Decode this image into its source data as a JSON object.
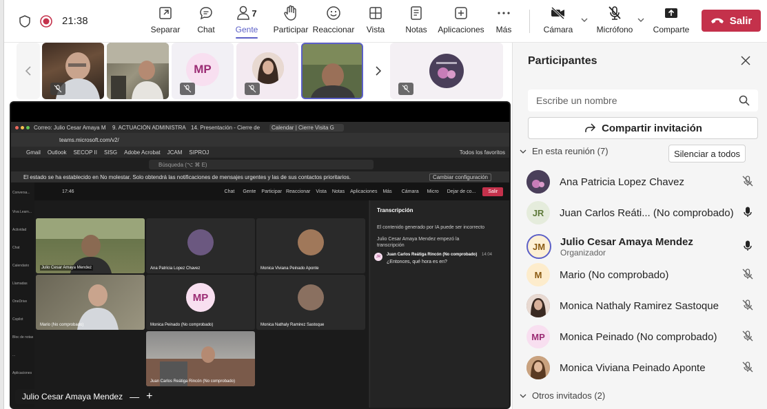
{
  "toolbar": {
    "time": "21:38",
    "buttons": [
      {
        "label": "Separar",
        "icon": "popout-icon"
      },
      {
        "label": "Chat",
        "icon": "chat-icon"
      },
      {
        "label": "Gente",
        "icon": "people-icon",
        "count": "7"
      },
      {
        "label": "Participar",
        "icon": "raise-hand-icon"
      },
      {
        "label": "Reaccionar",
        "icon": "react-icon"
      },
      {
        "label": "Vista",
        "icon": "view-icon"
      },
      {
        "label": "Notas",
        "icon": "notes-icon"
      },
      {
        "label": "Aplicaciones",
        "icon": "apps-icon"
      },
      {
        "label": "Más",
        "icon": "more-icon"
      }
    ],
    "camera_label": "Cámara",
    "mic_label": "Micrófono",
    "share_label": "Comparte",
    "leave_label": "Salir"
  },
  "strip": {
    "thumbs": [
      {
        "name": "video-1"
      },
      {
        "name": "video-2"
      },
      {
        "name": "avatar-mp",
        "initials": "MP"
      },
      {
        "name": "avatar-woman-1"
      },
      {
        "name": "video-3-selected"
      },
      {
        "name": "avatar-flower"
      }
    ]
  },
  "shared": {
    "tabs": [
      "Correo: Julio Cesar Amaya M",
      "9. ACTUACIÓN ADMINISTRA",
      "14. Presentación - Cierre de",
      "Calendar | Cierre Visita G"
    ],
    "url": "teams.microsoft.com/v2/",
    "bookmarks": [
      "Gmail",
      "Outlook",
      "SECOP II",
      "SISG",
      "Adobe Acrobat",
      "JCAM",
      "SIPROJ",
      "Todos los favoritos"
    ],
    "search_placeholder": "Búsqueda (⌥ ⌘ E)",
    "notice": "El estado se ha establecido en No molestar. Solo obtendrá las notificaciones de mensajes urgentes y las de sus contactos prioritarios.",
    "notice_button": "Cambiar configuración",
    "inner_time": "17:46",
    "inner_leave": "Salir",
    "inner_buttons": [
      "Chat",
      "Gente",
      "Participar",
      "Reaccionar",
      "Vista",
      "Notas",
      "Aplicaciones",
      "Más",
      "Cámara",
      "Micro",
      "Dejar de co..."
    ],
    "inner_people_count": "7",
    "rail": [
      "Conversa...",
      "Viva Learn...",
      "Actividad",
      "Chat",
      "Calendario",
      "Llamadas",
      "OneDrive",
      "Copilot",
      "Bloc de notas",
      "...",
      "Aplicaciones"
    ],
    "tiles": [
      {
        "label": "Julio Cesar Amaya Mendez"
      },
      {
        "label": "Ana Patricia Lopez Chavez"
      },
      {
        "label": "Monica Viviana Peinado Aponte"
      },
      {
        "label": "Mario (No comprobado)"
      },
      {
        "label": "Monica Peinado (No comprobado)",
        "initials": "MP"
      },
      {
        "label": "Monica Nathaly Ramirez Sastoque"
      },
      {
        "label": "Juan Carlos Reátiga Rincón (No comprobado)"
      }
    ],
    "transcript": {
      "title": "Transcripción",
      "ai_note": "El contenido generado por IA puede ser incorrecto",
      "started": "Julio Cesar Amaya Mendez empezó la transcripción",
      "speaker": "Juan Carlos Reátiga Rincón (No comprobado)",
      "speaker_initials": "JR",
      "speaker_time": "14:04",
      "message": "¿Entonces, qué hora es en?"
    },
    "presenter_label": "Julio Cesar Amaya Mendez"
  },
  "panel": {
    "title": "Participantes",
    "search_placeholder": "Escribe un nombre",
    "share_invite": "Compartir invitación",
    "in_meeting": "En esta reunión (7)",
    "mute_all": "Silenciar a todos",
    "participants": [
      {
        "name": "Ana Patricia Lopez Chavez",
        "initials": "",
        "mic": "muted",
        "bold": false,
        "role": "",
        "avatar_color": "#7a6a8a"
      },
      {
        "name": "Juan Carlos Reáti... (No comprobado)",
        "initials": "JR",
        "mic": "on",
        "bold": false,
        "role": "",
        "avatar_color": "#e5ecdc",
        "initials_color": "#5e7a3a"
      },
      {
        "name": "Julio Cesar Amaya Mendez",
        "initials": "JM",
        "mic": "on",
        "bold": true,
        "role": "Organizador",
        "avatar_color": "#fdf0d5",
        "initials_color": "#8a5a12"
      },
      {
        "name": "Mario (No comprobado)",
        "initials": "M",
        "mic": "muted",
        "bold": false,
        "role": "",
        "avatar_color": "#fdeccc",
        "initials_color": "#8a5a12"
      },
      {
        "name": "Monica Nathaly Ramirez Sastoque",
        "initials": "",
        "mic": "muted",
        "bold": false,
        "role": "",
        "avatar_color": "#8a7060"
      },
      {
        "name": "Monica Peinado (No comprobado)",
        "initials": "MP",
        "mic": "muted",
        "bold": false,
        "role": "",
        "avatar_color": "#f8dff0",
        "initials_color": "#9b2c74"
      },
      {
        "name": "Monica Viviana Peinado Aponte",
        "initials": "",
        "mic": "muted",
        "bold": false,
        "role": "",
        "avatar_color": "#a0785a"
      }
    ],
    "others": "Otros invitados (2)"
  },
  "colors": {
    "accent": "#5b5fc7",
    "leave": "#c4314b",
    "muted_icon": "#616161"
  }
}
